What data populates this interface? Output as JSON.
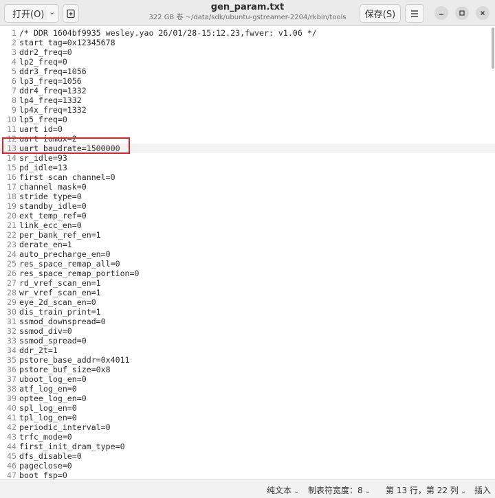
{
  "header": {
    "open_label": "打开(O)",
    "title": "gen_param.txt",
    "subtitle": "322 GB 卷 ~/data/sdk/ubuntu-gstreamer-2204/rkbin/tools",
    "save_label": "保存(S)",
    "icons": {
      "open_dropdown": "chevron-down-icon",
      "new_document": "new-document-icon",
      "menu": "hamburger-menu-icon",
      "minimize": "minimize-icon",
      "maximize": "maximize-icon",
      "close": "close-icon"
    }
  },
  "editor": {
    "current_line": 13,
    "highlight_color": "#e0202a",
    "lines": [
      {
        "n": "1",
        "text": "/* DDR 1604bf9935 wesley.yao 26/01/28-15:12.23,fwver: v1.06 */"
      },
      {
        "n": "2",
        "text": "start tag=0x12345678"
      },
      {
        "n": "3",
        "text": "ddr2_freq=0"
      },
      {
        "n": "4",
        "text": "lp2_freq=0"
      },
      {
        "n": "5",
        "text": "ddr3_freq=1056"
      },
      {
        "n": "6",
        "text": "lp3_freq=1056"
      },
      {
        "n": "7",
        "text": "ddr4_freq=1332"
      },
      {
        "n": "8",
        "text": "lp4_freq=1332"
      },
      {
        "n": "9",
        "text": "lp4x_freq=1332"
      },
      {
        "n": "10",
        "text": "lp5_freq=0"
      },
      {
        "n": "11",
        "text": "uart id=0"
      },
      {
        "n": "12",
        "text": "uart iomux=2"
      },
      {
        "n": "13",
        "text": "uart baudrate=1500000"
      },
      {
        "n": "14",
        "text": "sr_idle=93"
      },
      {
        "n": "15",
        "text": "pd_idle=13"
      },
      {
        "n": "16",
        "text": "first scan channel=0"
      },
      {
        "n": "17",
        "text": "channel mask=0"
      },
      {
        "n": "18",
        "text": "stride type=0"
      },
      {
        "n": "19",
        "text": "standby_idle=0"
      },
      {
        "n": "20",
        "text": "ext_temp_ref=0"
      },
      {
        "n": "21",
        "text": "link_ecc_en=0"
      },
      {
        "n": "22",
        "text": "per_bank_ref_en=1"
      },
      {
        "n": "23",
        "text": "derate_en=1"
      },
      {
        "n": "24",
        "text": "auto_precharge_en=0"
      },
      {
        "n": "25",
        "text": "res_space_remap_all=0"
      },
      {
        "n": "26",
        "text": "res_space_remap_portion=0"
      },
      {
        "n": "27",
        "text": "rd_vref_scan_en=1"
      },
      {
        "n": "28",
        "text": "wr_vref_scan_en=1"
      },
      {
        "n": "29",
        "text": "eye_2d_scan_en=0"
      },
      {
        "n": "30",
        "text": "dis_train_print=1"
      },
      {
        "n": "31",
        "text": "ssmod_downspread=0"
      },
      {
        "n": "32",
        "text": "ssmod_div=0"
      },
      {
        "n": "33",
        "text": "ssmod_spread=0"
      },
      {
        "n": "34",
        "text": "ddr_2t=1"
      },
      {
        "n": "35",
        "text": "pstore_base_addr=0x4011"
      },
      {
        "n": "36",
        "text": "pstore_buf_size=0x8"
      },
      {
        "n": "37",
        "text": "uboot_log_en=0"
      },
      {
        "n": "38",
        "text": "atf_log_en=0"
      },
      {
        "n": "39",
        "text": "optee_log_en=0"
      },
      {
        "n": "40",
        "text": "spl_log_en=0"
      },
      {
        "n": "41",
        "text": "tpl_log_en=0"
      },
      {
        "n": "42",
        "text": "periodic_interval=0"
      },
      {
        "n": "43",
        "text": "trfc_mode=0"
      },
      {
        "n": "44",
        "text": "first_init_dram_type=0"
      },
      {
        "n": "45",
        "text": "dfs_disable=0"
      },
      {
        "n": "46",
        "text": "pageclose=0"
      },
      {
        "n": "47",
        "text": "boot_fsp=0"
      }
    ]
  },
  "status": {
    "syntax": "纯文本",
    "tab_label": "制表符宽度：",
    "tab_value": "8",
    "position": "第 13 行，第 22 列",
    "insert_mode": "插入"
  }
}
